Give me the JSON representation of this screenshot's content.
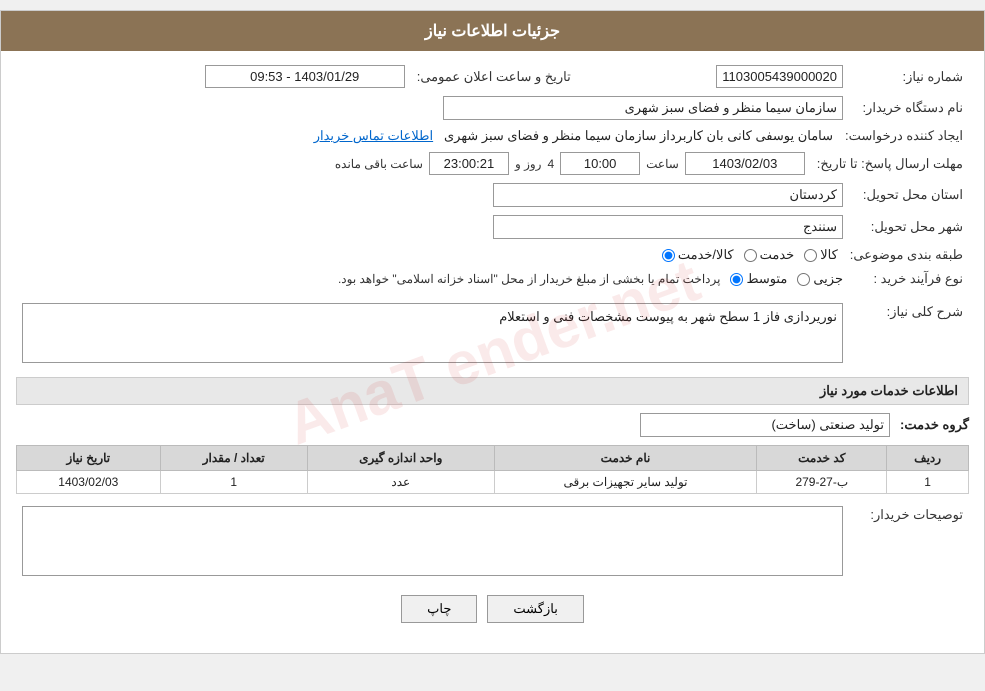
{
  "page": {
    "title": "جزئیات اطلاعات نیاز"
  },
  "header": {
    "need_number_label": "شماره نیاز:",
    "need_number_value": "1103005439000020",
    "announce_datetime_label": "تاریخ و ساعت اعلان عمومی:",
    "announce_datetime_value": "1403/01/29 - 09:53",
    "buyer_org_label": "نام دستگاه خریدار:",
    "buyer_org_value": "سازمان سیما  منظر و فضای سبز شهری",
    "creator_label": "ایجاد کننده درخواست:",
    "creator_name": "سامان یوسفی کانی بان کاربرداز سازمان سیما  منظر و فضای سبز شهری",
    "creator_link": "اطلاعات تماس خریدار",
    "deadline_label": "مهلت ارسال پاسخ: تا تاریخ:",
    "deadline_date": "1403/02/03",
    "deadline_time_label": "ساعت",
    "deadline_time_value": "10:00",
    "deadline_days_label": "روز و",
    "deadline_days_value": "4",
    "deadline_remaining_label": "ساعت باقی مانده",
    "deadline_timer": "23:00:21",
    "province_label": "استان محل تحویل:",
    "province_value": "کردستان",
    "city_label": "شهر محل تحویل:",
    "city_value": "سنندج",
    "category_label": "طبقه بندی موضوعی:",
    "category_options": [
      {
        "label": "کالا",
        "value": "kala"
      },
      {
        "label": "خدمت",
        "value": "khedmat"
      },
      {
        "label": "کالا/خدمت",
        "value": "kala_khedmat"
      }
    ],
    "category_selected": "kala_khedmat",
    "process_label": "نوع فرآیند خرید :",
    "process_options": [
      {
        "label": "جزیی",
        "value": "jozii"
      },
      {
        "label": "متوسط",
        "value": "motevaset"
      }
    ],
    "process_selected": "motevaset",
    "process_note": "پرداخت تمام یا بخشی از مبلغ خریدار از محل \"اسناد خزانه اسلامی\" خواهد بود."
  },
  "need_description": {
    "section_title": "شرح کلی نیاز:",
    "description": "نوریردازی فاز 1 سطح شهر به پیوست مشخصات فنی و استعلام"
  },
  "services_section": {
    "section_title": "اطلاعات خدمات مورد نیاز",
    "service_group_label": "گروه خدمت:",
    "service_group_value": "تولید صنعتی (ساخت)",
    "table_headers": {
      "row_num": "ردیف",
      "service_code": "کد خدمت",
      "service_name": "نام خدمت",
      "unit": "واحد اندازه گیری",
      "quantity": "تعداد / مقدار",
      "date": "تاریخ نیاز"
    },
    "rows": [
      {
        "row_num": "1",
        "service_code": "ب-27-279",
        "service_name": "تولید سایر تجهیزات برقی",
        "unit": "عدد",
        "quantity": "1",
        "date": "1403/02/03"
      }
    ]
  },
  "buyer_comments": {
    "section_title": "توصیحات خریدار:",
    "description": ""
  },
  "buttons": {
    "back_label": "بازگشت",
    "print_label": "چاپ"
  }
}
